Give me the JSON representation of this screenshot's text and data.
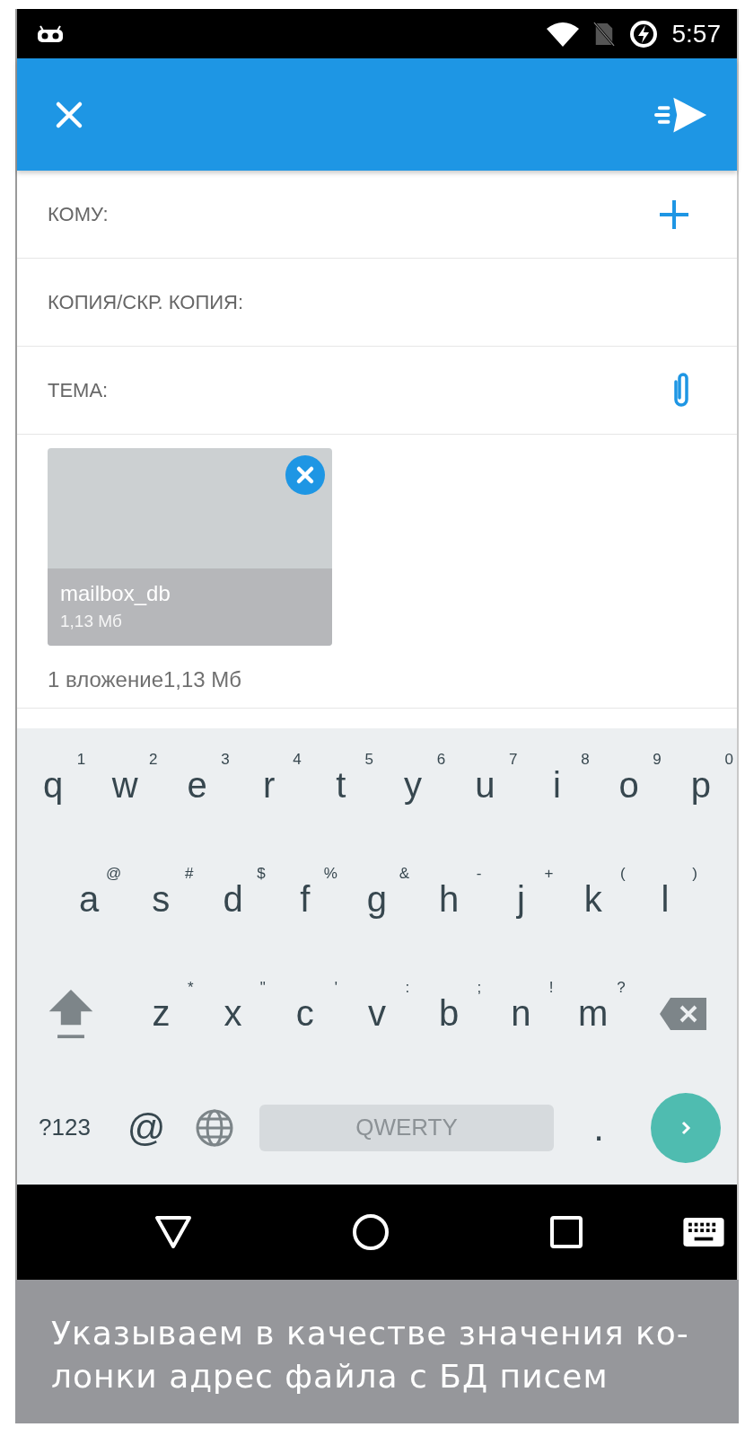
{
  "status_bar": {
    "time": "5:57"
  },
  "fields": [
    {
      "label": "КОМУ:",
      "kind": "recipients"
    },
    {
      "label": "КОПИЯ/СКР. КОПИЯ:",
      "kind": "plain"
    },
    {
      "label": "ТЕМА:",
      "kind": "subject"
    }
  ],
  "attachments": [
    {
      "name": "mailbox_db",
      "size": "1,13  Мб"
    }
  ],
  "attachment_summary": "1 вложение1,13  Мб",
  "keyboard": {
    "rows": [
      {
        "keys": [
          {
            "kind": "letter",
            "label": "q",
            "hint": "1"
          },
          {
            "kind": "letter",
            "label": "w",
            "hint": "2"
          },
          {
            "kind": "letter",
            "label": "e",
            "hint": "3"
          },
          {
            "kind": "letter",
            "label": "r",
            "hint": "4"
          },
          {
            "kind": "letter",
            "label": "t",
            "hint": "5"
          },
          {
            "kind": "letter",
            "label": "y",
            "hint": "6"
          },
          {
            "kind": "letter",
            "label": "u",
            "hint": "7"
          },
          {
            "kind": "letter",
            "label": "i",
            "hint": "8"
          },
          {
            "kind": "letter",
            "label": "o",
            "hint": "9"
          },
          {
            "kind": "letter",
            "label": "p",
            "hint": "0"
          }
        ]
      },
      {
        "keys": [
          {
            "kind": "letter",
            "label": "a",
            "hint": "@"
          },
          {
            "kind": "letter",
            "label": "s",
            "hint": "#"
          },
          {
            "kind": "letter",
            "label": "d",
            "hint": "$"
          },
          {
            "kind": "letter",
            "label": "f",
            "hint": "%"
          },
          {
            "kind": "letter",
            "label": "g",
            "hint": "&"
          },
          {
            "kind": "letter",
            "label": "h",
            "hint": "-"
          },
          {
            "kind": "letter",
            "label": "j",
            "hint": "+"
          },
          {
            "kind": "letter",
            "label": "k",
            "hint": "("
          },
          {
            "kind": "letter",
            "label": "l",
            "hint": ")"
          }
        ]
      },
      {
        "keys": [
          {
            "kind": "shift"
          },
          {
            "kind": "letter",
            "label": "z",
            "hint": "*"
          },
          {
            "kind": "letter",
            "label": "x",
            "hint": "\""
          },
          {
            "kind": "letter",
            "label": "c",
            "hint": "'"
          },
          {
            "kind": "letter",
            "label": "v",
            "hint": ":"
          },
          {
            "kind": "letter",
            "label": "b",
            "hint": ";"
          },
          {
            "kind": "letter",
            "label": "n",
            "hint": "!"
          },
          {
            "kind": "letter",
            "label": "m",
            "hint": "?"
          },
          {
            "kind": "backspace"
          }
        ]
      },
      {
        "keys": [
          {
            "kind": "symbols",
            "label": "?123"
          },
          {
            "kind": "char",
            "label": "@"
          },
          {
            "kind": "globe"
          },
          {
            "kind": "space",
            "label": "QWERTY"
          },
          {
            "kind": "char",
            "label": "."
          },
          {
            "kind": "enter"
          }
        ]
      }
    ]
  },
  "caption": "Указываем в качестве значения ко-\nлонки адрес файла с БД писем"
}
